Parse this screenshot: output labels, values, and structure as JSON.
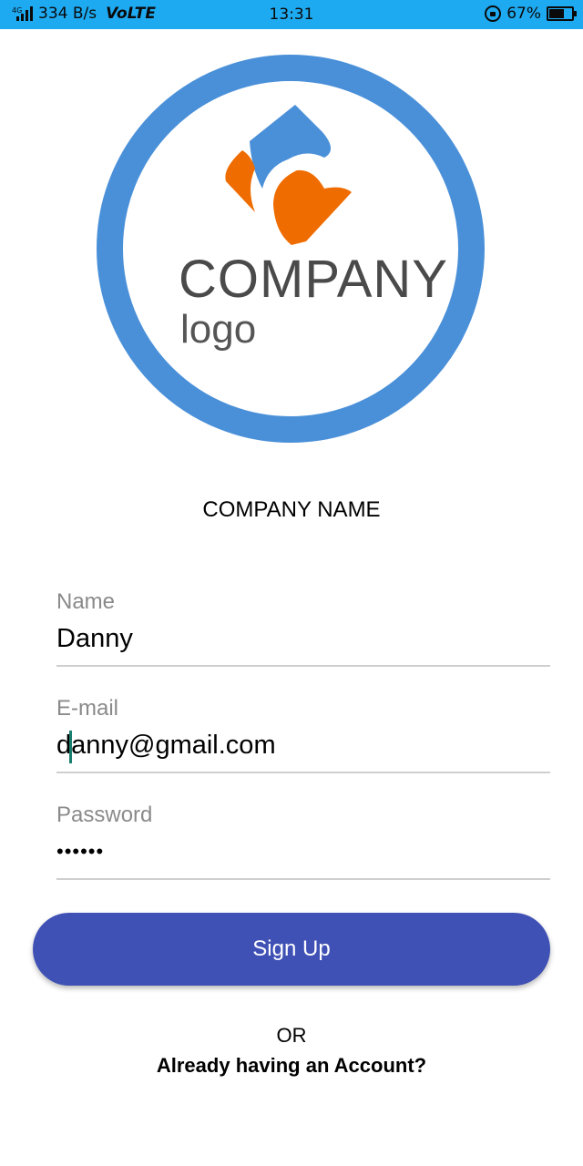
{
  "status_bar": {
    "network_type": "4G",
    "data_speed": "334 B/s",
    "volte": "VoLTE",
    "time": "13:31",
    "battery_percent": "67%",
    "battery_level": 0.67,
    "icons": [
      "signal-icon",
      "rotation-lock-icon",
      "battery-icon"
    ]
  },
  "logo": {
    "wordmark": "COMPANY",
    "subtext": "logo",
    "colors": {
      "ring": "#4a90d9",
      "blue_shape": "#4a90d9",
      "orange_shape": "#ef6c00",
      "text": "#4a4a4a"
    }
  },
  "company_name": "COMPANY NAME",
  "form": {
    "name": {
      "label": "Name",
      "value": "Danny"
    },
    "email": {
      "label": "E-mail",
      "value": "danny@gmail.com"
    },
    "password": {
      "label": "Password",
      "value": "••••••"
    }
  },
  "signup_button": {
    "label": "Sign Up",
    "color": "#3f51b5"
  },
  "or_text": "OR",
  "login_link": "Already having an Account?",
  "colors": {
    "status_bar": "#1eaaf1",
    "cursor": "#1a7f6e"
  }
}
